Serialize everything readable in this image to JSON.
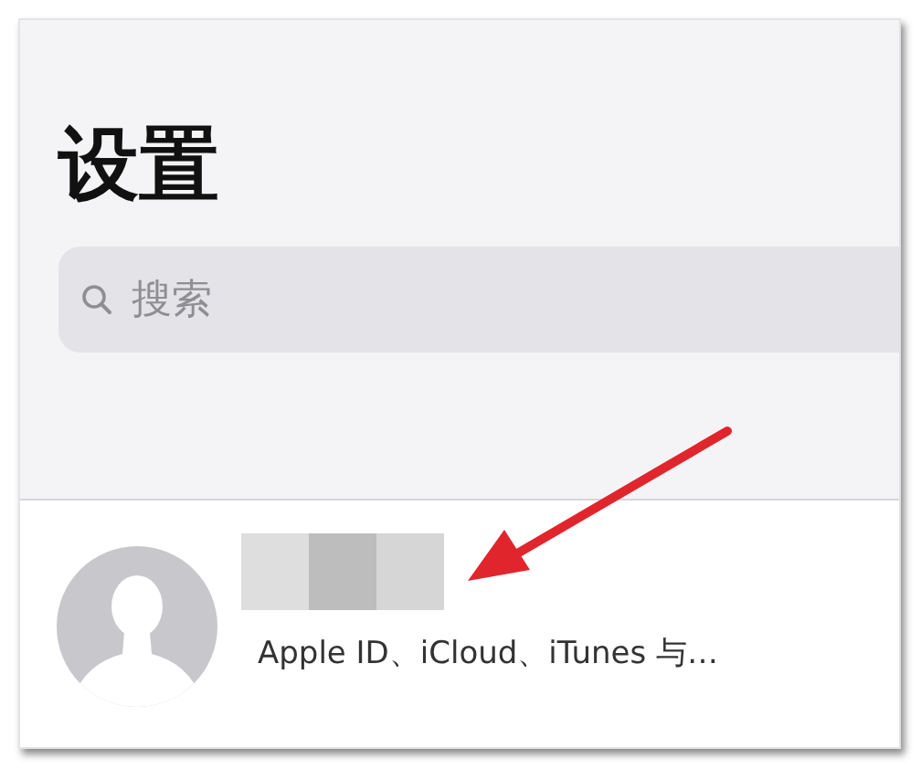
{
  "title": "设置",
  "search": {
    "placeholder": "搜索"
  },
  "account": {
    "name_redacted": true,
    "subtitle": "Apple ID、iCloud、iTunes 与…"
  }
}
